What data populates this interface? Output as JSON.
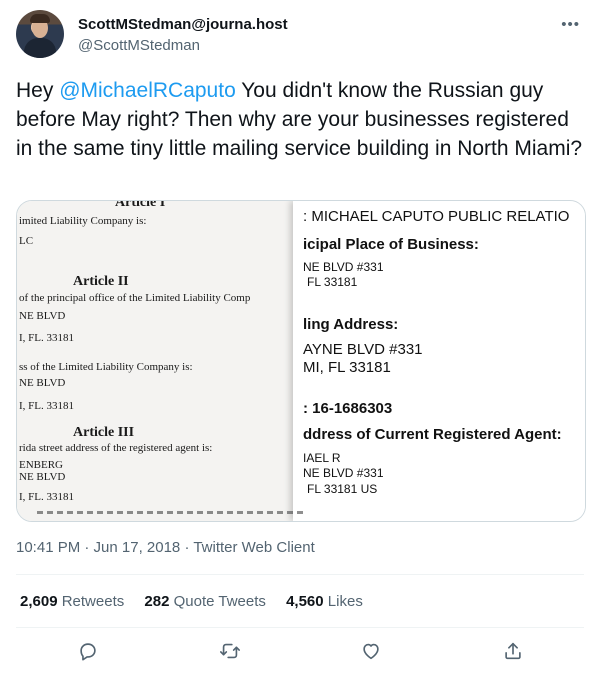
{
  "author": {
    "display_name": "ScottMStedman@journa.host",
    "handle": "@ScottMStedman",
    "more_icon": "more-horizontal-icon"
  },
  "tweet": {
    "text_prefix": "Hey ",
    "mention": "@MichaelRCaputo",
    "text_rest": " You didn't know the Russian guy before May right? Then why are your businesses registered in the same tiny little mailing service building in North Miami?"
  },
  "media": {
    "left_doc": {
      "lines": [
        "Article I",
        "imited Liability Company is:",
        "LC",
        "Article II",
        "of the principal office of the Limited Liability Comp",
        "NE BLVD",
        "I, FL.  33181",
        "ss of the Limited Liability Company is:",
        "NE BLVD",
        "I, FL.  33181",
        "Article III",
        "rida street address of the registered agent is:",
        "ENBERG",
        "NE BLVD",
        "I, FL.  33181"
      ]
    },
    "right_doc": {
      "lines": [
        ": MICHAEL CAPUTO PUBLIC RELATIO",
        "icipal  Place of Business:",
        "NE BLVD #331",
        "FL  33181",
        "ling Address:",
        "AYNE BLVD #331",
        "MI,  FL  33181",
        ": 16-1686303",
        "ddress of Current Registered Agent:",
        "IAEL R",
        "NE BLVD #331",
        "FL  33181  US"
      ]
    }
  },
  "meta": {
    "time": "10:41 PM",
    "date": "Jun 17, 2018",
    "client": "Twitter Web Client",
    "line": "10:41 PM · Jun 17, 2018 · Twitter Web Client"
  },
  "stats": {
    "retweets_count": "2,609",
    "retweets_label": "Retweets",
    "quotes_count": "282",
    "quotes_label": "Quote Tweets",
    "likes_count": "4,560",
    "likes_label": "Likes"
  },
  "actions": [
    "reply-icon",
    "retweet-icon",
    "like-icon",
    "share-icon"
  ]
}
